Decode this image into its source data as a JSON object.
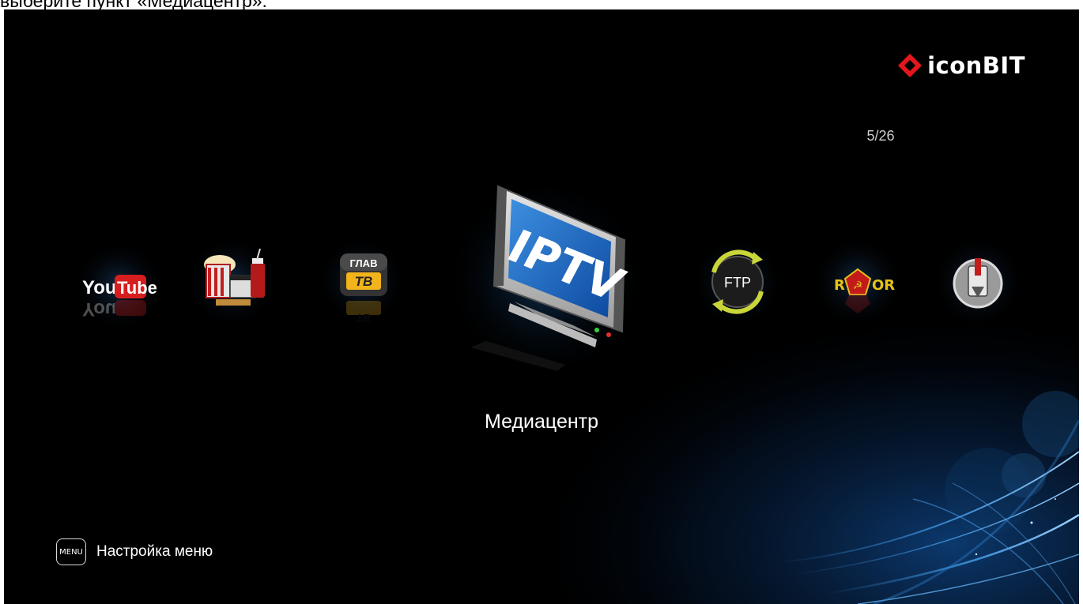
{
  "caption": "выберите пункт «Медиацентр».",
  "brand": {
    "name": "iconBIT",
    "accent": "#e3171c"
  },
  "counter": "5/26",
  "apps": [
    {
      "name": "youtube",
      "label_a": "You",
      "label_b": "Tube",
      "icon": "youtube-icon"
    },
    {
      "name": "cinema",
      "icon": "cinema-icon"
    },
    {
      "name": "glavtv",
      "label_top": "ГЛАВ",
      "label_bottom": "ТВ",
      "icon": "glavtv-icon"
    },
    {
      "name": "iptv",
      "label": "IPTV",
      "icon": "tv-monitor-icon",
      "selected": true
    },
    {
      "name": "ftp",
      "label": "FTP",
      "icon": "ftp-arrows-icon"
    },
    {
      "name": "rutor",
      "label_left": "R",
      "label_right": "OR",
      "icon": "rutor-icon"
    },
    {
      "name": "torrent",
      "icon": "torrent-client-icon"
    }
  ],
  "selected_label": "Медиацентр",
  "menu_hint": {
    "key": "MENU",
    "label": "Настройка меню"
  }
}
